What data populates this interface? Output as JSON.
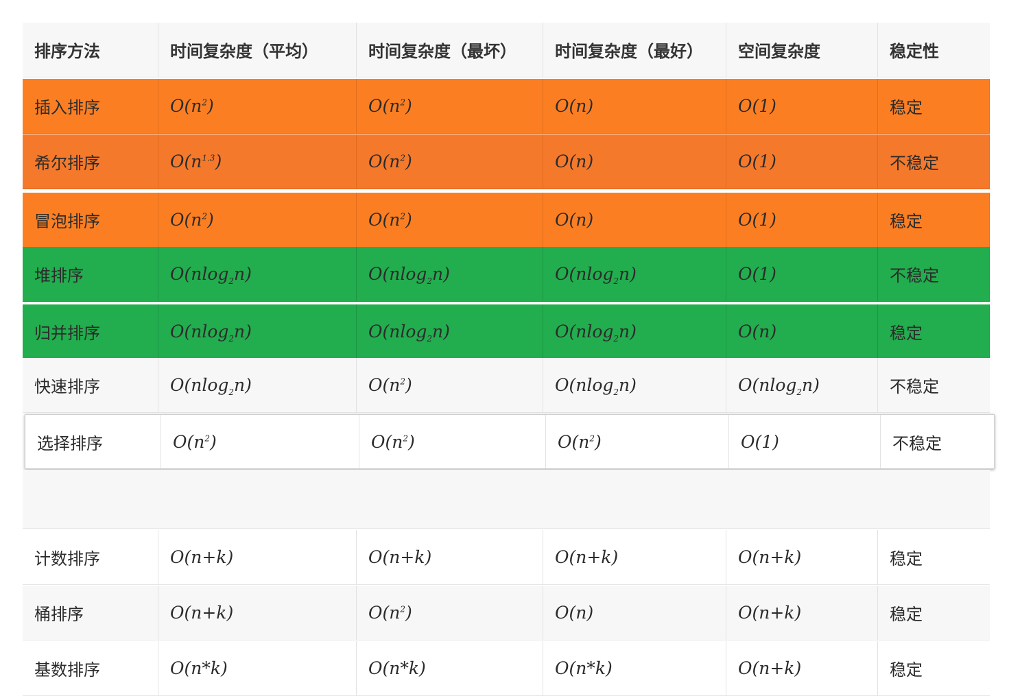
{
  "headers": [
    "排序方法",
    "时间复杂度（平均）",
    "时间复杂度（最坏）",
    "时间复杂度（最好）",
    "空间复杂度",
    "稳定性"
  ],
  "rows": [
    {
      "name": "插入排序",
      "avg": {
        "base": "O(n",
        "sup": "2",
        "tail": ")"
      },
      "worst": {
        "base": "O(n",
        "sup": "2",
        "tail": ")"
      },
      "best": {
        "base": "O(n)"
      },
      "space": {
        "base": "O(1)"
      },
      "stable": "稳定",
      "highlight": "orange"
    },
    {
      "name": "希尔排序",
      "avg": {
        "base": "O(n",
        "sup": "1.3",
        "tail": ")"
      },
      "worst": {
        "base": "O(n",
        "sup": "2",
        "tail": ")"
      },
      "best": {
        "base": "O(n)"
      },
      "space": {
        "base": "O(1)"
      },
      "stable": "不稳定",
      "highlight": "orange"
    },
    {
      "name": "冒泡排序",
      "avg": {
        "base": "O(n",
        "sup": "2",
        "tail": ")"
      },
      "worst": {
        "base": "O(n",
        "sup": "2",
        "tail": ")"
      },
      "best": {
        "base": "O(n)"
      },
      "space": {
        "base": "O(1)"
      },
      "stable": "稳定",
      "highlight": "orange"
    },
    {
      "name": "堆排序",
      "avg": {
        "base": "O(nlog",
        "sub": "2",
        "tail": "n)"
      },
      "worst": {
        "base": "O(nlog",
        "sub": "2",
        "tail": "n)"
      },
      "best": {
        "base": "O(nlog",
        "sub": "2",
        "tail": "n)"
      },
      "space": {
        "base": "O(1)"
      },
      "stable": "不稳定",
      "highlight": "green"
    },
    {
      "name": "归并排序",
      "avg": {
        "base": "O(nlog",
        "sub": "2",
        "tail": "n)"
      },
      "worst": {
        "base": "O(nlog",
        "sub": "2",
        "tail": "n)"
      },
      "best": {
        "base": "O(nlog",
        "sub": "2",
        "tail": "n)"
      },
      "space": {
        "base": "O(n)"
      },
      "stable": "稳定",
      "highlight": "green"
    },
    {
      "name": "快速排序",
      "avg": {
        "base": "O(nlog",
        "sub": "2",
        "tail": "n)"
      },
      "worst": {
        "base": "O(n",
        "sup": "2",
        "tail": ")"
      },
      "best": {
        "base": "O(nlog",
        "sub": "2",
        "tail": "n)"
      },
      "space": {
        "base": "O(nlog",
        "sub": "2",
        "tail": "n)"
      },
      "stable": "不稳定",
      "highlight": "none"
    },
    {
      "name": "选择排序",
      "avg": {
        "base": "O(n",
        "sup": "2",
        "tail": ")"
      },
      "worst": {
        "base": "O(n",
        "sup": "2",
        "tail": ")"
      },
      "best": {
        "base": "O(n",
        "sup": "2",
        "tail": ")"
      },
      "space": {
        "base": "O(1)"
      },
      "stable": "不稳定",
      "highlight": "white"
    },
    {
      "name": "计数排序",
      "avg": {
        "base": "O(n+k)"
      },
      "worst": {
        "base": "O(n+k)"
      },
      "best": {
        "base": "O(n+k)"
      },
      "space": {
        "base": "O(n+k)"
      },
      "stable": "稳定",
      "highlight": "plain"
    },
    {
      "name": "桶排序",
      "avg": {
        "base": "O(n+k)"
      },
      "worst": {
        "base": "O(n",
        "sup": "2",
        "tail": ")"
      },
      "best": {
        "base": "O(n)"
      },
      "space": {
        "base": "O(n+k)"
      },
      "stable": "稳定",
      "highlight": "none"
    },
    {
      "name": "基数排序",
      "avg": {
        "base": "O(n*k)"
      },
      "worst": {
        "base": "O(n*k)"
      },
      "best": {
        "base": "O(n*k)"
      },
      "space": {
        "base": "O(n+k)"
      },
      "stable": "稳定",
      "highlight": "plain"
    }
  ],
  "colors": {
    "orange": "#fb7f22",
    "green": "#22ad4e",
    "row_bg": "#f7f7f7",
    "text": "#2b2b2b"
  }
}
